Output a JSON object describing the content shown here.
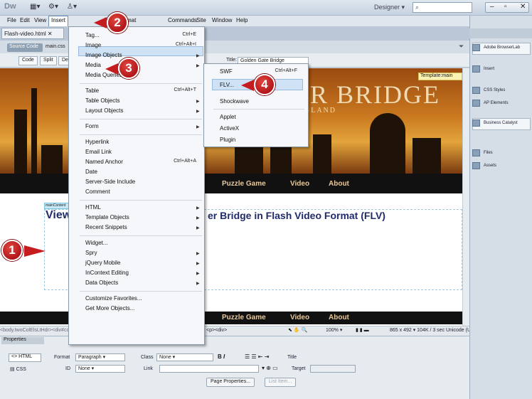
{
  "app": {
    "logo": "Dw",
    "workspace": "Designer",
    "window_controls": [
      "–",
      "▫",
      "✕"
    ]
  },
  "menubar": [
    "File",
    "Edit",
    "View",
    "Insert",
    "Format",
    "Commands",
    "Site",
    "Window",
    "Help"
  ],
  "document": {
    "tab_label": "Flash-video.html",
    "source_code_label": "Source Code",
    "related_file": "main.css",
    "view_buttons": [
      "Code",
      "Split",
      "Design"
    ],
    "title_label": "Title:",
    "title_value": "Golden Gate Bridge"
  },
  "insert_menu": {
    "items": [
      {
        "label": "Tag...",
        "shortcut": "Ctrl+E"
      },
      {
        "label": "Image",
        "shortcut": "Ctrl+Alt+I"
      },
      {
        "label": "Image Objects",
        "shortcut": ""
      },
      {
        "label": "Media",
        "shortcut": ""
      },
      {
        "label": "Media Queries...",
        "shortcut": ""
      },
      {
        "label": "Table",
        "shortcut": "Ctrl+Alt+T"
      },
      {
        "label": "Table Objects",
        "shortcut": ""
      },
      {
        "label": "Layout Objects",
        "shortcut": ""
      },
      {
        "label": "Form",
        "shortcut": ""
      },
      {
        "label": "Hyperlink",
        "shortcut": ""
      },
      {
        "label": "Email Link",
        "shortcut": ""
      },
      {
        "label": "Named Anchor",
        "shortcut": "Ctrl+Alt+A"
      },
      {
        "label": "Date",
        "shortcut": ""
      },
      {
        "label": "Server-Side Include",
        "shortcut": ""
      },
      {
        "label": "Comment",
        "shortcut": ""
      },
      {
        "label": "HTML",
        "shortcut": ""
      },
      {
        "label": "Template Objects",
        "shortcut": ""
      },
      {
        "label": "Recent Snippets",
        "shortcut": ""
      },
      {
        "label": "Widget...",
        "shortcut": ""
      },
      {
        "label": "Spry",
        "shortcut": ""
      },
      {
        "label": "jQuery Mobile",
        "shortcut": ""
      },
      {
        "label": "InContext Editing",
        "shortcut": ""
      },
      {
        "label": "Data Objects",
        "shortcut": ""
      },
      {
        "label": "Customize Favorites...",
        "shortcut": ""
      },
      {
        "label": "Get More Objects...",
        "shortcut": ""
      }
    ]
  },
  "media_submenu": {
    "items": [
      {
        "label": "SWF",
        "shortcut": "Ctrl+Alt+F"
      },
      {
        "label": "FLV...",
        "shortcut": ""
      },
      {
        "label": "Shockwave",
        "shortcut": ""
      },
      {
        "label": "Applet",
        "shortcut": ""
      },
      {
        "label": "ActiveX",
        "shortcut": ""
      },
      {
        "label": "Plugin",
        "shortcut": ""
      }
    ]
  },
  "canvas": {
    "template_tag": "Template:main",
    "banner_title": "ER BRIDGE",
    "banner_sub": "GLAND",
    "nav_links": [
      "Puzzle Game",
      "Video",
      "About"
    ],
    "maincontent_tag": "mainContent",
    "heading_left": "View",
    "heading_right": "er Bridge in Flash Video Format (FLV)"
  },
  "statusbar": {
    "tag_selector": "<body.twoColElsLtHdr><div#container><div#mainContent>",
    "tags": "<p><div>",
    "zoom": "100%",
    "size": "865 x 492 ▾ 104K / 3 sec Unicode (UTF-8)"
  },
  "properties": {
    "title": "Properties",
    "html_btn": "<> HTML",
    "css_btn": "CSS",
    "format_label": "Format",
    "format_value": "Paragraph",
    "class_label": "Class",
    "class_value": "None",
    "id_label": "ID",
    "id_value": "None",
    "link_label": "Link",
    "title_label": "Title",
    "target_label": "Target",
    "page_properties": "Page Properties...",
    "list_item": "List Item..."
  },
  "right_panel": {
    "items": [
      "Adobe BrowserLab",
      "Insert",
      "CSS Styles",
      "AP Elements",
      "Business Catalyst",
      "Files",
      "Assets"
    ]
  },
  "callouts": [
    "1",
    "2",
    "3",
    "4"
  ]
}
